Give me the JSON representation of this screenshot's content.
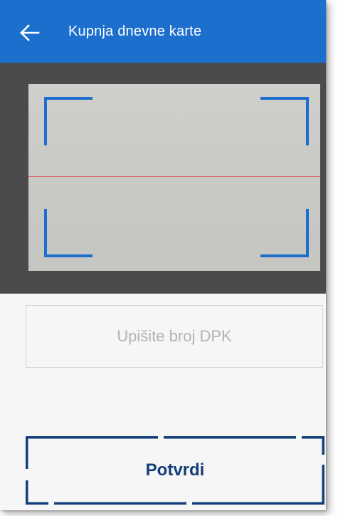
{
  "appbar": {
    "title": "Kupnja dnevne karte",
    "back_icon": "arrow-left-icon",
    "background_color": "#1d6fce"
  },
  "scanner": {
    "frame_color": "#1d6fce",
    "scan_line_color": "#e06060"
  },
  "dpk_input": {
    "placeholder": "Upišite broj DPK",
    "value": ""
  },
  "confirm_button": {
    "label": "Potvrdi",
    "text_color": "#123f78"
  }
}
